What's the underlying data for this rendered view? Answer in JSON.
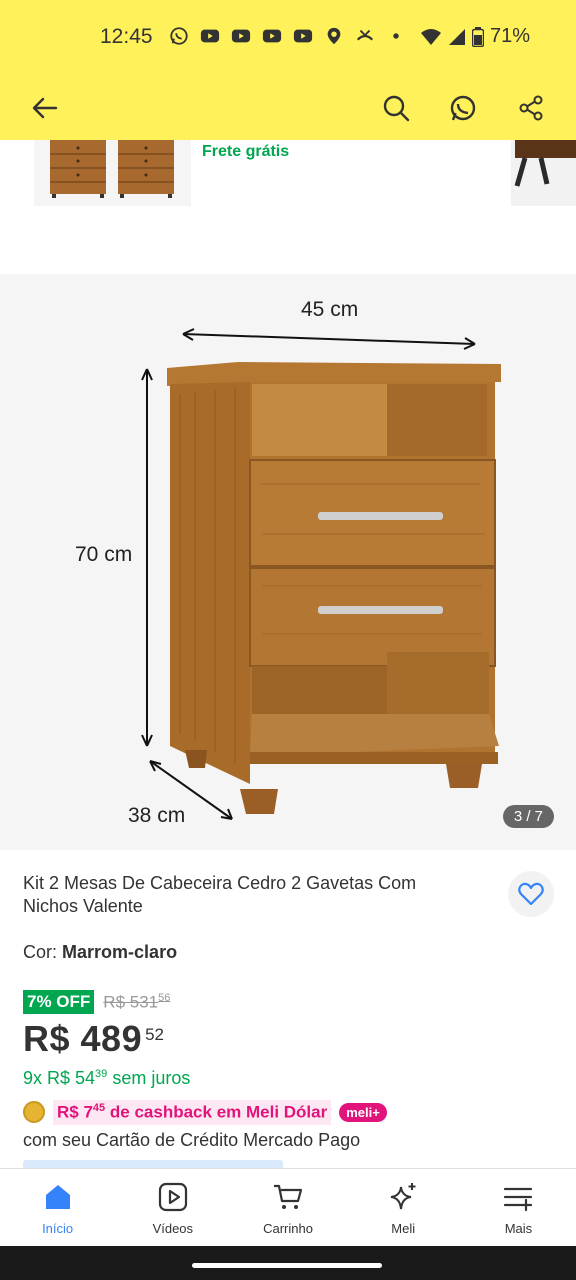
{
  "status": {
    "time": "12:45",
    "battery": "71%",
    "notification_icons": [
      "whatsapp-icon",
      "youtube-icon",
      "youtube-icon",
      "youtube-icon",
      "youtube-icon",
      "maps-icon",
      "missed-call-icon",
      "dot-icon"
    ]
  },
  "header": {
    "back_icon": "arrow-left-icon",
    "search_icon": "search-icon",
    "whatsapp_share_icon": "whatsapp-share-icon",
    "share_icon": "share-icon",
    "bg_color": "#fff159"
  },
  "related": {
    "free_shipping": "Frete grátis"
  },
  "gallery": {
    "width_label": "45 cm",
    "height_label": "70 cm",
    "depth_label": "38 cm",
    "counter": "3 / 7"
  },
  "product": {
    "title": "Kit 2 Mesas De Cabeceira Cedro 2 Gavetas Com Nichos Valente",
    "color_label": "Cor:",
    "color_value": "Marrom-claro",
    "discount_badge": "7% OFF",
    "old_price": "R$ 531",
    "old_price_cents": "56",
    "price": "R$ 489",
    "price_cents": "52",
    "installments": "9x R$ 54",
    "installments_cents": "39",
    "installments_suffix": "sem juros",
    "cashback_prefix": "R$ 7",
    "cashback_cents": "45",
    "cashback_suffix": "de cashback em Meli Dólar",
    "meli_badge": "meli+",
    "card_note": "com seu Cartão de Crédito Mercado Pago",
    "accent_green": "#00a650",
    "accent_pink": "#e0147b"
  },
  "bottom_nav": {
    "items": [
      {
        "label": "Início",
        "icon": "home-icon",
        "active": true
      },
      {
        "label": "Vídeos",
        "icon": "play-icon",
        "active": false
      },
      {
        "label": "Carrinho",
        "icon": "cart-icon",
        "active": false
      },
      {
        "label": "Meli",
        "icon": "sparkle-icon",
        "active": false
      },
      {
        "label": "Mais",
        "icon": "menu-plus-icon",
        "active": false
      }
    ],
    "active_color": "#3483fa"
  }
}
